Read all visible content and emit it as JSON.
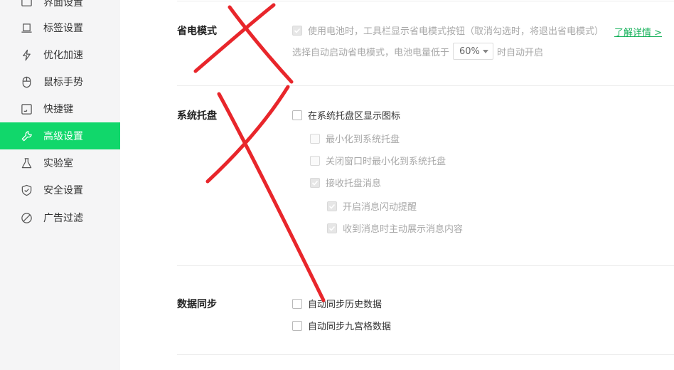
{
  "sidebar": {
    "items": [
      {
        "label": "界面设置",
        "icon": "window-icon",
        "active": false
      },
      {
        "label": "标签设置",
        "icon": "tab-icon",
        "active": false
      },
      {
        "label": "优化加速",
        "icon": "lightning-icon",
        "active": false
      },
      {
        "label": "鼠标手势",
        "icon": "mouse-icon",
        "active": false
      },
      {
        "label": "快捷键",
        "icon": "keyboard-icon",
        "active": false
      },
      {
        "label": "高级设置",
        "icon": "wrench-icon",
        "active": true
      },
      {
        "label": "实验室",
        "icon": "flask-icon",
        "active": false
      },
      {
        "label": "安全设置",
        "icon": "shield-icon",
        "active": false
      },
      {
        "label": "广告过滤",
        "icon": "block-icon",
        "active": false
      }
    ],
    "active_color": "#11d76b"
  },
  "power_saving": {
    "title": "省电模式",
    "battery_option": "使用电池时，工具栏显示省电模式按钮（取消勾选时，将退出省电模式）",
    "auto_prefix": "选择自动启动省电模式，电池电量低于",
    "threshold_value": "60%",
    "auto_suffix": "时自动开启",
    "learn_more": "了解详情 >"
  },
  "system_tray": {
    "title": "系统托盘",
    "show_icon": "在系统托盘区显示图标",
    "minimize_to_tray": "最小化到系统托盘",
    "close_minimize": "关闭窗口时最小化到系统托盘",
    "receive_messages": "接收托盘消息",
    "flash_reminder": "开启消息闪动提醒",
    "show_content": "收到消息时主动展示消息内容"
  },
  "data_sync": {
    "title": "数据同步",
    "sync_history": "自动同步历史数据",
    "sync_grid": "自动同步九宫格数据"
  },
  "annotation_color": "#e8262b"
}
